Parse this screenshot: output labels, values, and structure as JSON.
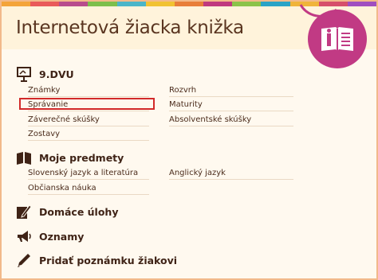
{
  "header": {
    "title": "Internetová žiacka knižka"
  },
  "colors": {
    "stripes": [
      "#f4a43a",
      "#e95a5a",
      "#b84c8c",
      "#7cbf4c",
      "#4bb5c8",
      "#f1c232",
      "#e87e3a",
      "#c0397f",
      "#8bc34a",
      "#2aa3c6",
      "#f0b43a",
      "#d64f6b",
      "#a04ec0"
    ],
    "logo": "#c13a84",
    "highlight": "#d22a2a"
  },
  "class_section": {
    "label": "9.DVU",
    "icon": "presentation-board-icon",
    "items_left": [
      "Známky",
      "Správanie",
      "Záverečné skúšky",
      "Zostavy"
    ],
    "items_right": [
      "Rozvrh",
      "Maturity",
      "Absolventské skúšky"
    ]
  },
  "subjects_section": {
    "label": "Moje predmety",
    "icon": "books-icon",
    "items_left": [
      "Slovenský jazyk a literatúra",
      "Občianska náuka"
    ],
    "items_right": [
      "Anglický jazyk"
    ]
  },
  "homework": {
    "label": "Domáce úlohy",
    "icon": "pencil-paper-icon"
  },
  "announcements": {
    "label": "Oznamy",
    "icon": "megaphone-icon"
  },
  "add_note": {
    "label": "Pridať poznámku žiakovi",
    "icon": "pencil-icon"
  }
}
